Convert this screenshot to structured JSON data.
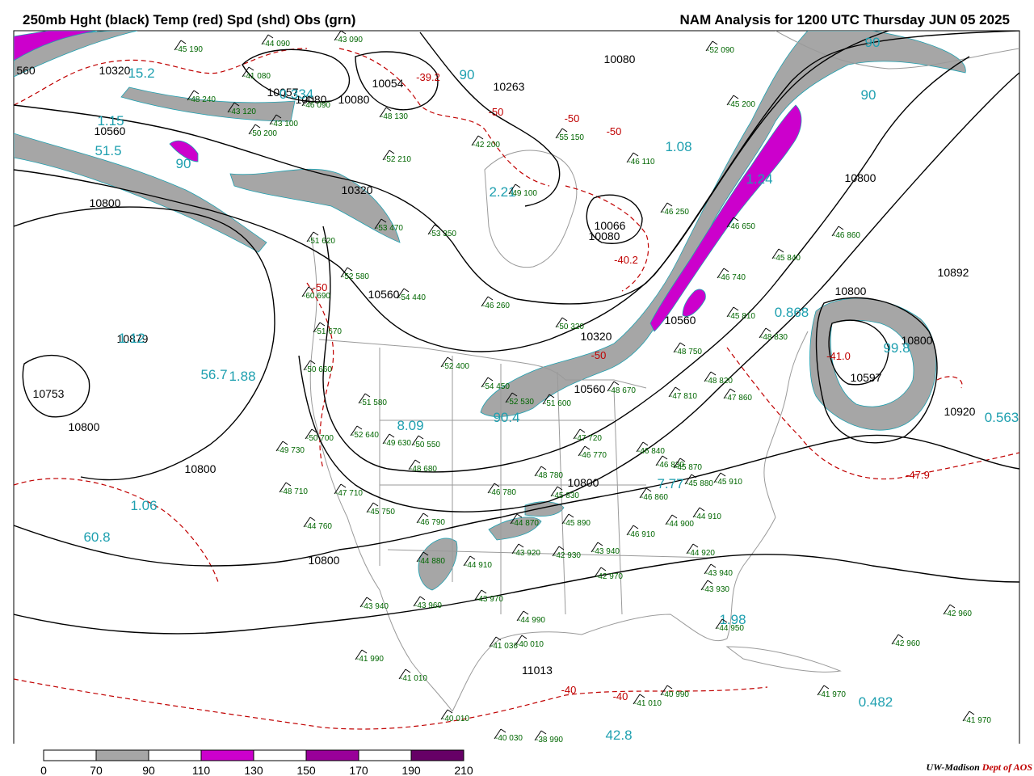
{
  "header": {
    "left_title": "250mb Hght (black) Temp (red) Spd (shd) Obs (grn)",
    "right_title": "NAM Analysis for 1200 UTC Thursday  JUN 05 2025"
  },
  "credit": {
    "org": "UW-Madison",
    "dept": "Dept of AOS"
  },
  "colors": {
    "height_contour": "#000000",
    "temperature": "#c00000",
    "speed_70_90": "#a6a6a6",
    "speed_110_130": "#cc00cc",
    "speed_150_170": "#990099",
    "speed_190_210": "#660066",
    "observations": "#006600",
    "speed_labels": "#1fa0b0",
    "geography": "#9a9a9a"
  },
  "legend": {
    "ticks": [
      "0",
      "70",
      "90",
      "110",
      "130",
      "150",
      "170",
      "190",
      "210"
    ],
    "fills": [
      "#ffffff",
      "#a6a6a6",
      "#ffffff",
      "#cc00cc",
      "#ffffff",
      "#990099",
      "#ffffff",
      "#660066"
    ]
  },
  "height_labels": [
    "560",
    "10320",
    "10054",
    "10080",
    "10263",
    "10080",
    "10057",
    "10080",
    "10560",
    "10800",
    "10320",
    "10560",
    "10066",
    "10080",
    "10320",
    "10800",
    "10879",
    "10753",
    "10800",
    "10800",
    "10560",
    "10560",
    "10800",
    "10892",
    "10597",
    "10800",
    "10920",
    "10800",
    "10800",
    "11013"
  ],
  "temp_labels": [
    "-39.2",
    "-50",
    "-50",
    "-50",
    "-40.2",
    "-50",
    "-50",
    "-41.0",
    "-47.9",
    "-40",
    "-40"
  ],
  "speed_labels": [
    "15.2",
    "90",
    "90",
    "1.15",
    "51.5",
    "1.08",
    "2.21",
    "90",
    "90",
    "1.24",
    "0.334",
    "1.12",
    "56.7",
    "1.88",
    "0.868",
    "99.8",
    "0.563",
    "90.4",
    "8.09",
    "7.77",
    "1.06",
    "60.8",
    "1.98",
    "0.482",
    "42.8"
  ],
  "obs": [
    "-45 190",
    "-44 090",
    "-43 090",
    "-52 090",
    "-41 080",
    "-48 240",
    "-43 120",
    "-46 090",
    "-43 100",
    "-48 130",
    "-50 200",
    "-55 150",
    "-42 200",
    "-45 200",
    "-52 210",
    "-46 110",
    "-49 100",
    "-53 350",
    "-53 470",
    "-51 620",
    "-52 580",
    "-54 440",
    "-46 250",
    "-46 650",
    "-45 840",
    "-46 860",
    "-60 690",
    "-46 740",
    "-45 810",
    "-48 830",
    "-50 320",
    "-46 260",
    "-51 670",
    "-52 400",
    "-48 750",
    "-50 660",
    "-54 450",
    "-52 530",
    "-51 600",
    "-48 670",
    "-47 810",
    "-48 820",
    "-47 860",
    "-51 580",
    "-50 700",
    "-52 640",
    "-49 730",
    "-49 630",
    "-50 550",
    "-47 720",
    "-48 680",
    "-46 770",
    "-46 840",
    "-48 710",
    "-47 710",
    "-46 830",
    "-45 870",
    "-45 880",
    "-45 910",
    "-46 780",
    "-48 780",
    "-45 830",
    "-45 750",
    "-46 790",
    "-44 760",
    "-46 860",
    "-44 870",
    "-45 890",
    "-46 910",
    "-44 910",
    "-44 900",
    "-44 880",
    "-44 910",
    "-43 920",
    "-42 930",
    "-43 940",
    "-42 970",
    "-44 920",
    "-43 940",
    "-43 930",
    "-43 940",
    "-43 960",
    "-43 970",
    "-44 990",
    "-44 950",
    "-41 036",
    "-40 010",
    "-41 990",
    "-41 010",
    "-41 010",
    "-40 990",
    "-41 970",
    "-42 960",
    "-42 960",
    "-40 010",
    "-40 030",
    "-38 990",
    "-41 970"
  ]
}
